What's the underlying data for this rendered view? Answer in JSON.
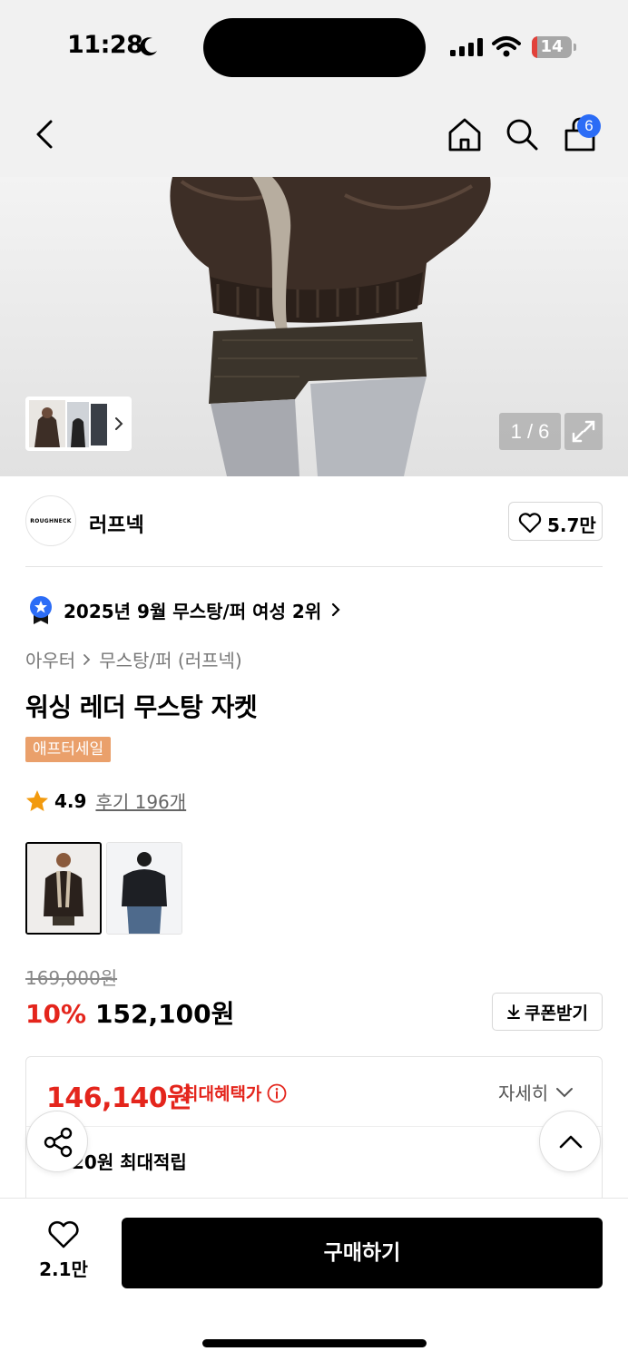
{
  "status_bar": {
    "time": "11:28",
    "battery": "14",
    "battery_level": 0.14
  },
  "nav": {
    "cart_count": "6",
    "icons": [
      "back-icon",
      "home-icon",
      "search-icon",
      "bag-icon"
    ]
  },
  "gallery": {
    "pager": "1 / 6"
  },
  "brand": {
    "logo_text": "ROUGHNECK",
    "name": "러프넥",
    "likes": "5.7만"
  },
  "ranking": {
    "text": "2025년 9월 무스탕/퍼 여성 2위"
  },
  "breadcrumb": {
    "category": "아우터",
    "subcategory": "무스탕/퍼 (러프넥)"
  },
  "product": {
    "title": "워싱 레더 무스탕 자켓",
    "tag": "애프터세일",
    "rating": "4.9",
    "review_link": "후기 196개",
    "original_price": "169,000원",
    "discount": "10%",
    "price": "152,100원",
    "coupon_label": "쿠폰받기"
  },
  "benefit": {
    "max_price": "146,140원",
    "max_label": "최대혜택가",
    "detail_label": "자세히",
    "points_text": "20원 최대적립"
  },
  "bottom": {
    "wish_count": "2.1만",
    "buy_label": "구매하기"
  },
  "colors": {
    "accent_red": "#e4251c",
    "tag_orange": "#eaa06b",
    "badge_blue": "#2b6cf6"
  }
}
